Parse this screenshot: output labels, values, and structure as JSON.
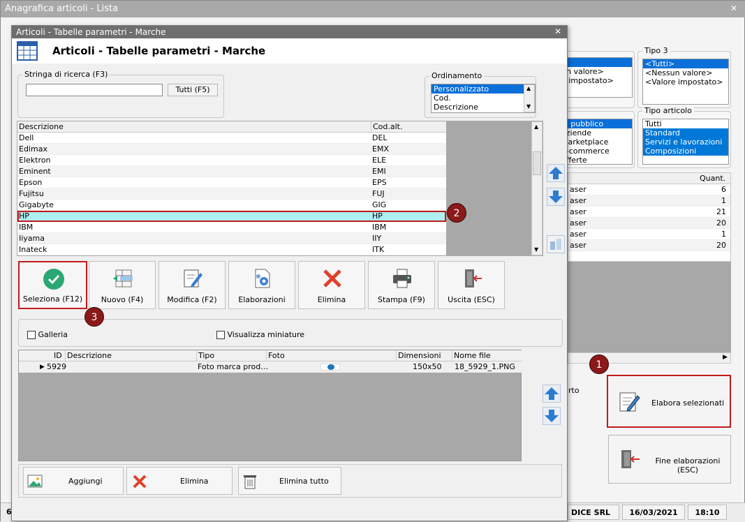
{
  "back": {
    "title": "Anagrafica articoli  - Lista",
    "tipo3": {
      "legend": "Tipo 3",
      "items": [
        "<Tutti>",
        "<Nessun valore>",
        "<Valore impostato>"
      ]
    },
    "tipo2_partial": {
      "items": [
        "",
        "un valore>",
        "e impostato>"
      ]
    },
    "tipo_articolo": {
      "legend": "Tipo articolo",
      "items": [
        "Tutti",
        "Standard",
        "Servizi e lavorazioni",
        "Composizioni"
      ]
    },
    "canali_partial": {
      "items": [
        "al pubblico",
        "aziende",
        "Marketplace",
        "e-commerce",
        "offerte"
      ]
    },
    "quant_header": "Quant.",
    "rows": [
      {
        "desc": "aser",
        "q": "6"
      },
      {
        "desc": "aser",
        "q": "1"
      },
      {
        "desc": "aser",
        "q": "21"
      },
      {
        "desc": "aser",
        "q": "20"
      },
      {
        "desc": "aser",
        "q": "1"
      },
      {
        "desc": "aser",
        "q": "20"
      }
    ],
    "partial_text": "rto",
    "elabora_label": "Elabora selezionati",
    "fine_label": "Fine elaborazioni (ESC)",
    "status": {
      "company": "DICE SRL",
      "date": "16/03/2021",
      "time": "18:10",
      "left": "6"
    }
  },
  "dialog": {
    "title": "Articoli - Tabelle parametri - Marche",
    "header": "Articoli - Tabelle parametri - Marche",
    "search": {
      "legend": "Stringa di ricerca (F3)",
      "value": "",
      "tutti": "Tutti (F5)"
    },
    "order": {
      "legend": "Ordinamento",
      "items": [
        "Personalizzato",
        "Cod.",
        "Descrizione"
      ]
    },
    "grid": {
      "headers": [
        "Descrizione",
        "Cod.alt."
      ],
      "rows": [
        [
          "Dell",
          "DEL"
        ],
        [
          "Edimax",
          "EMX"
        ],
        [
          "Elektron",
          "ELE"
        ],
        [
          "Eminent",
          "EMI"
        ],
        [
          "Epson",
          "EPS"
        ],
        [
          "Fujitsu",
          "FUJ"
        ],
        [
          "Gigabyte",
          "GIG"
        ],
        [
          "HP",
          "HP"
        ],
        [
          "IBM",
          "IBM"
        ],
        [
          "Iiyama",
          "IIY"
        ],
        [
          "Inateck",
          "ITK"
        ]
      ]
    },
    "toolbar": {
      "seleziona": "Seleziona (F12)",
      "nuovo": "Nuovo (F4)",
      "modifica": "Modifica (F2)",
      "elaborazioni": "Elaborazioni",
      "elimina": "Elimina",
      "stampa": "Stampa (F9)",
      "uscita": "Uscita (ESC)"
    },
    "options": {
      "galleria": "Galleria",
      "miniature": "Visualizza miniature"
    },
    "files": {
      "headers": [
        "ID",
        "Descrizione",
        "Tipo",
        "Foto",
        "Dimensioni",
        "Nome file"
      ],
      "row": {
        "id": "5929",
        "desc": "",
        "tipo": "Foto marca prod…",
        "dim": "150x50",
        "nome": "18_5929_1.PNG"
      }
    },
    "bottom": {
      "aggiungi": "Aggiungi",
      "elimina": "Elimina",
      "elimina_tutto": "Elimina tutto"
    }
  },
  "badges": [
    "1",
    "2",
    "3"
  ],
  "colors": {
    "accent": "#0078d7",
    "highlight": "#aef0f2",
    "marker": "#c11a1a"
  }
}
